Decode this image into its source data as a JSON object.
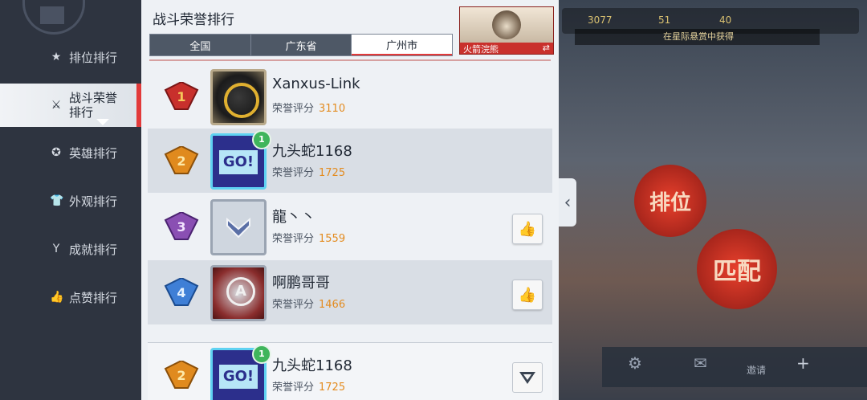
{
  "sidebar": {
    "items": [
      {
        "label": "排位排行",
        "icon": "star-icon"
      },
      {
        "label": "战斗荣誉排行",
        "icon": "crossed-swords-icon"
      },
      {
        "label": "英雄排行",
        "icon": "hero-icon"
      },
      {
        "label": "外观排行",
        "icon": "shirt-icon"
      },
      {
        "label": "成就排行",
        "icon": "trophy-icon"
      },
      {
        "label": "点赞排行",
        "icon": "thumbs-up-icon"
      }
    ],
    "active_index": 1
  },
  "panel": {
    "title": "战斗荣誉排行",
    "tabs": [
      "全国",
      "广东省",
      "广州市"
    ],
    "active_tab": 2,
    "hero_card": {
      "name": "火箭浣熊",
      "swap_icon": "swap-icon"
    }
  },
  "ranking": {
    "score_label": "荣誉评分",
    "rows": [
      {
        "rank": "1",
        "name": "Xanxus-Link",
        "score": "3110",
        "medal_color": "#c8302c"
      },
      {
        "rank": "2",
        "name": "九头蛇1168",
        "score": "1725",
        "medal_color": "#e08a1e",
        "level": "1"
      },
      {
        "rank": "3",
        "name": "龍丶丶",
        "score": "1559",
        "medal_color": "#8a4fb3",
        "like_icon": "thumbs-up-icon"
      },
      {
        "rank": "4",
        "name": "啊鹏哥哥",
        "score": "1466",
        "medal_color": "#3f7fd6",
        "like_icon": "thumbs-up-icon"
      }
    ],
    "self_row": {
      "rank": "2",
      "name": "九头蛇1168",
      "score": "1725",
      "medal_color": "#e08a1e",
      "level": "1"
    }
  },
  "background": {
    "resource_1": "3077",
    "resource_2": "51",
    "resource_3": "40",
    "banner_text": "在星际悬赏中获得",
    "circle_rank": "排位",
    "circle_match": "匹配",
    "invite_label": "邀请",
    "plus_label": "+"
  }
}
